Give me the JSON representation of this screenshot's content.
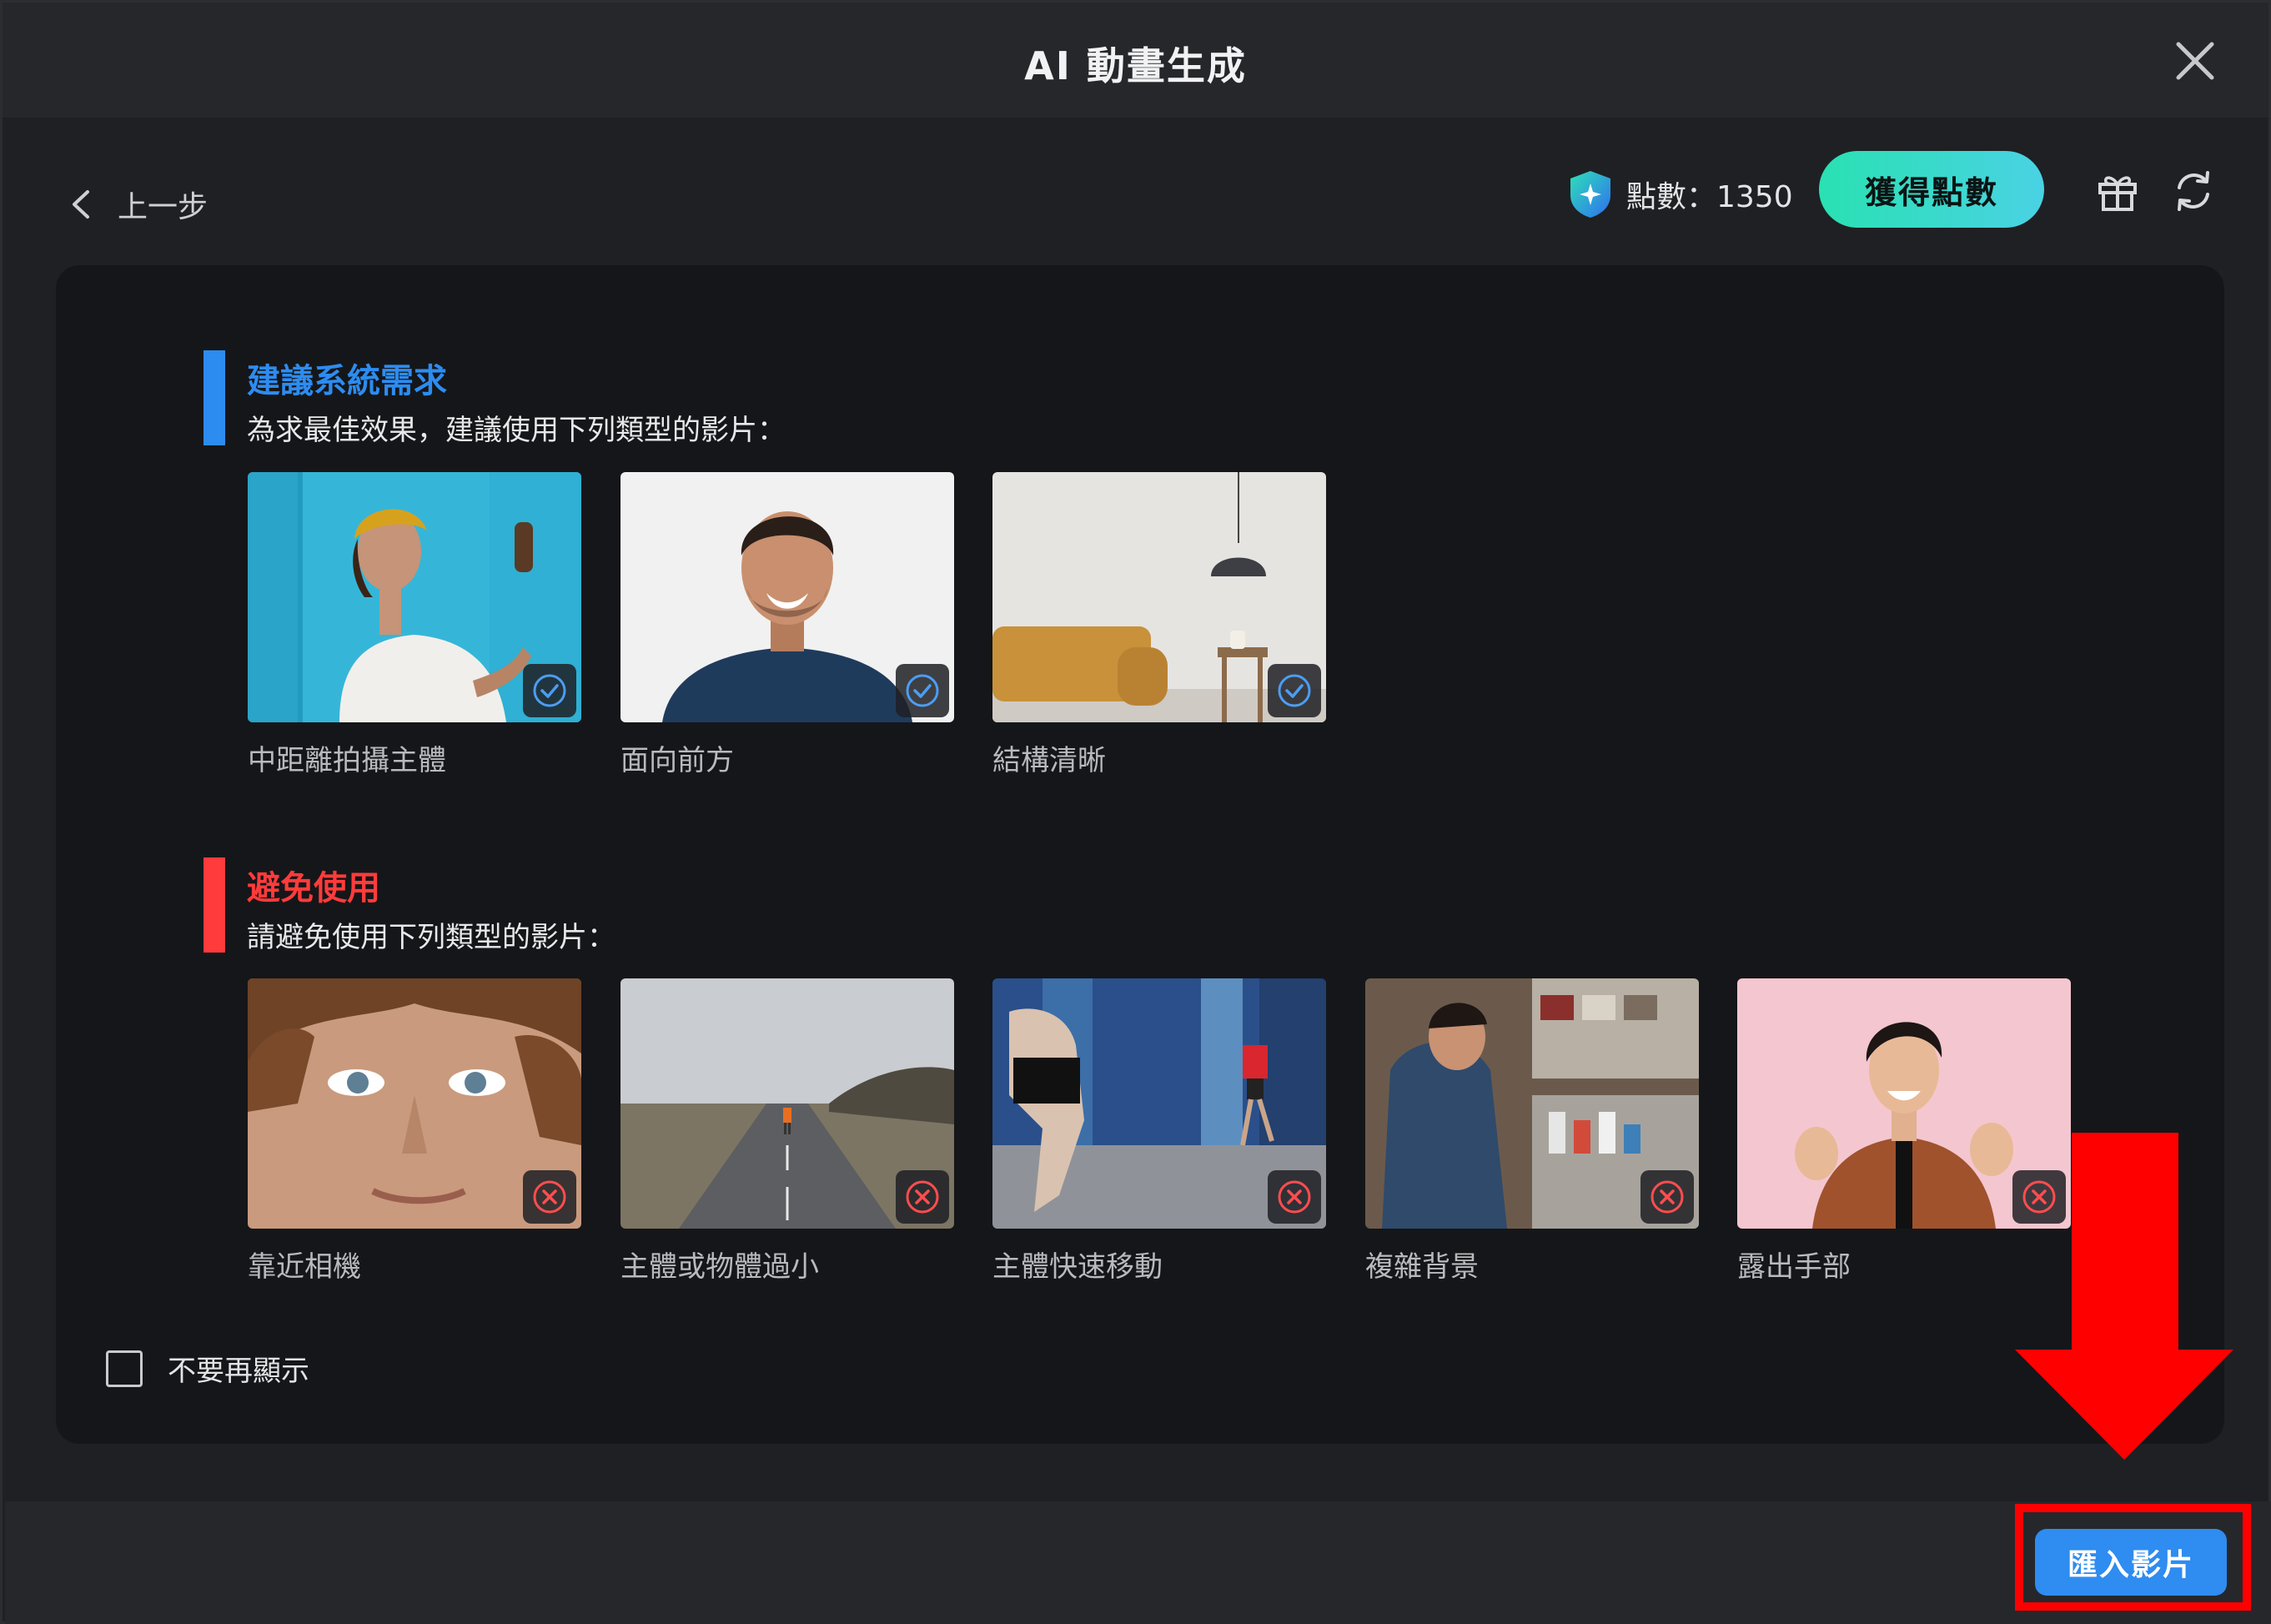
{
  "window": {
    "title": "AI 動畫生成"
  },
  "nav": {
    "back_label": "上一步"
  },
  "points": {
    "label": "點數：1350",
    "get_points_label": "獲得點數"
  },
  "recommended": {
    "title": "建議系統需求",
    "subtitle": "為求最佳效果，建議使用下列類型的影片：",
    "accent": "#2d8cf0",
    "items": [
      {
        "label": "中距離拍攝主體",
        "status": "check-icon"
      },
      {
        "label": "面向前方",
        "status": "check-icon"
      },
      {
        "label": "結構清晰",
        "status": "check-icon"
      }
    ]
  },
  "avoid": {
    "title": "避免使用",
    "subtitle": "請避免使用下列類型的影片：",
    "accent": "#ff3b3b",
    "items": [
      {
        "label": "靠近相機",
        "status": "cross-icon"
      },
      {
        "label": "主體或物體過小",
        "status": "cross-icon"
      },
      {
        "label": "主體快速移動",
        "status": "cross-icon"
      },
      {
        "label": "複雜背景",
        "status": "cross-icon"
      },
      {
        "label": "露出手部",
        "status": "cross-icon"
      }
    ]
  },
  "options": {
    "dont_show_again": "不要再顯示",
    "checked": false
  },
  "footer": {
    "import_label": "匯入影片"
  },
  "colors": {
    "primary": "#2f8cf0",
    "teal_gradient_start": "#29e1b2",
    "teal_gradient_end": "#4ad2e4",
    "highlight": "#ff0000"
  }
}
